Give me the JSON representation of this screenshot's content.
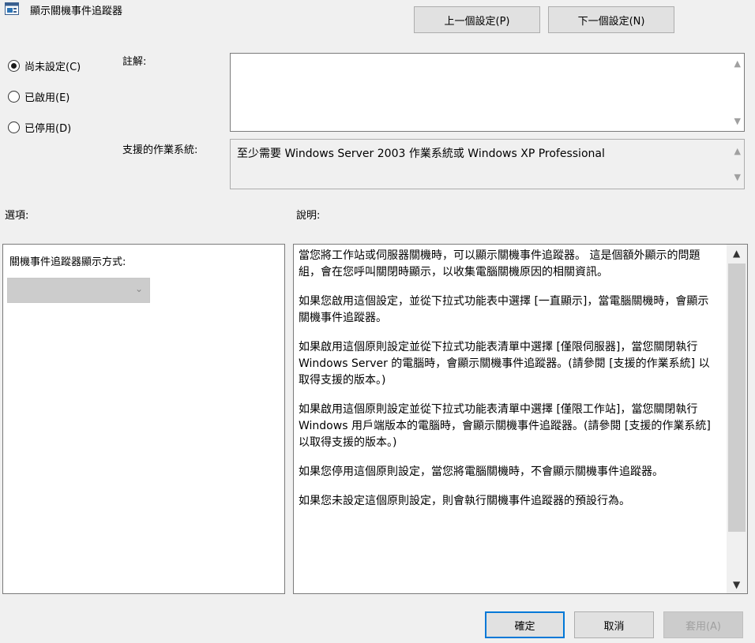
{
  "window": {
    "title": "顯示關機事件追蹤器"
  },
  "nav": {
    "prev_label": "上一個設定(P)",
    "next_label": "下一個設定(N)"
  },
  "state": {
    "options": [
      {
        "label": "尚未設定(C)",
        "checked": true
      },
      {
        "label": "已啟用(E)",
        "checked": false
      },
      {
        "label": "已停用(D)",
        "checked": false
      }
    ]
  },
  "comment": {
    "label": "註解:",
    "value": ""
  },
  "supported": {
    "label": "支援的作業系統:",
    "value": "至少需要 Windows Server 2003 作業系統或 Windows XP Professional"
  },
  "options_section": {
    "label": "選項:",
    "dropdown_label": "關機事件追蹤器顯示方式:",
    "dropdown_value": ""
  },
  "help": {
    "label": "說明:",
    "paragraphs": [
      "當您將工作站或伺服器關機時，可以顯示關機事件追蹤器。 這是個額外顯示的問題組，會在您呼叫關閉時顯示，以收集電腦關機原因的相關資訊。",
      "如果您啟用這個設定，並從下拉式功能表中選擇 [一直顯示]，當電腦關機時，會顯示關機事件追蹤器。",
      "如果啟用這個原則設定並從下拉式功能表清單中選擇 [僅限伺服器]，當您關閉執行 Windows Server 的電腦時，會顯示關機事件追蹤器。(請參閱 [支援的作業系統] 以取得支援的版本。)",
      "如果啟用這個原則設定並從下拉式功能表清單中選擇 [僅限工作站]，當您關閉執行 Windows 用戶端版本的電腦時，會顯示關機事件追蹤器。(請參閱 [支援的作業系統] 以取得支援的版本。)",
      "如果您停用這個原則設定，當您將電腦關機時，不會顯示關機事件追蹤器。",
      "如果您未設定這個原則設定，則會執行關機事件追蹤器的預設行為。"
    ]
  },
  "footer": {
    "ok_label": "確定",
    "cancel_label": "取消",
    "apply_label": "套用(A)"
  },
  "colors": {
    "accent": "#0078d7",
    "background": "#f0f0f0"
  }
}
